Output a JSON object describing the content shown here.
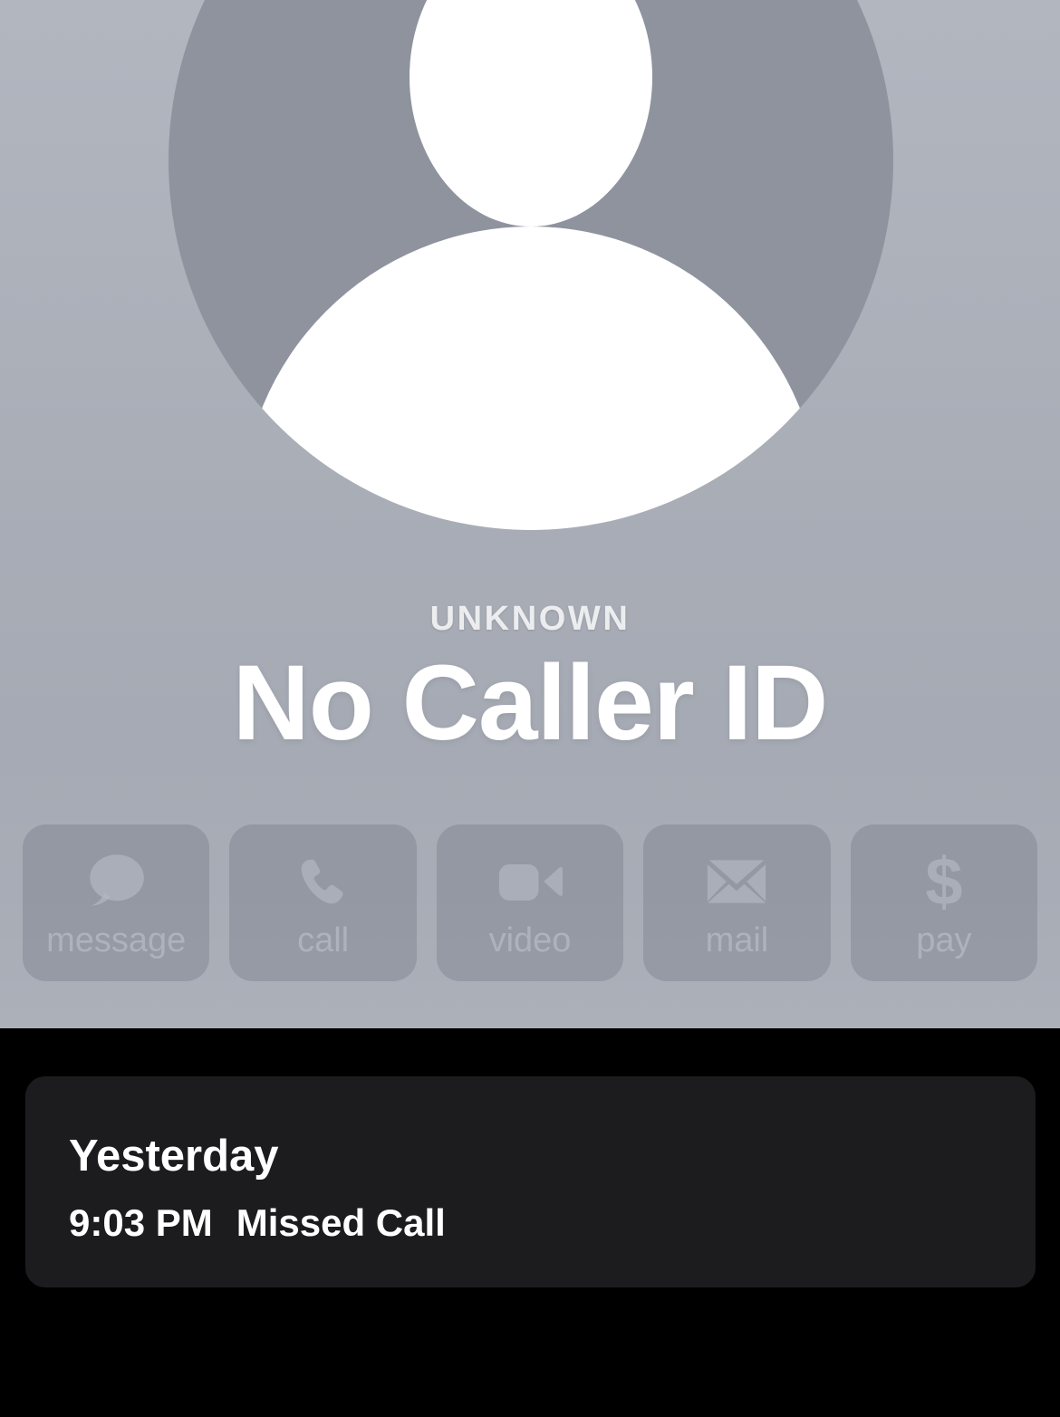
{
  "poster": {
    "avatar": {
      "icon": "person-placeholder-icon",
      "circle_color": "#8e939e",
      "glyph_color": "#ffffff"
    },
    "background_top_color": "#b2b6bf",
    "background_bottom_color": "#acb0b9",
    "eyebrow": "UNKNOWN",
    "display_name": "No Caller ID"
  },
  "actions": [
    {
      "id": "message",
      "label": "message",
      "icon": "message-bubble-icon"
    },
    {
      "id": "call",
      "label": "call",
      "icon": "phone-handset-icon"
    },
    {
      "id": "video",
      "label": "video",
      "icon": "video-camera-icon"
    },
    {
      "id": "mail",
      "label": "mail",
      "icon": "envelope-icon"
    },
    {
      "id": "pay",
      "label": "pay",
      "icon": "dollar-sign-icon"
    }
  ],
  "history": {
    "card_color": "#1c1c1e",
    "day": "Yesterday",
    "entries": [
      {
        "time": "9:03 PM",
        "type": "Missed Call"
      }
    ]
  }
}
